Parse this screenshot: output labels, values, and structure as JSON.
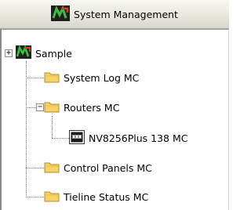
{
  "header": {
    "title": "System Management",
    "icon": "mv-logo-icon"
  },
  "tree": {
    "root": {
      "label": "Sample",
      "icon": "mv-logo-icon",
      "expander": "+"
    },
    "items": [
      {
        "label": "System Log MC",
        "icon": "folder-icon"
      },
      {
        "label": "Routers MC",
        "icon": "folder-icon",
        "expander": "−"
      },
      {
        "label": "NV8256Plus 138 MC",
        "icon": "router-device-icon"
      },
      {
        "label": "Control Panels MC",
        "icon": "folder-icon"
      },
      {
        "label": "Tieline Status MC",
        "icon": "folder-icon"
      }
    ]
  },
  "colors": {
    "folder_fill": "#f6d36a",
    "folder_stroke": "#b88a1c",
    "logo_green": "#2f9b2f",
    "logo_red": "#d23a2a"
  }
}
